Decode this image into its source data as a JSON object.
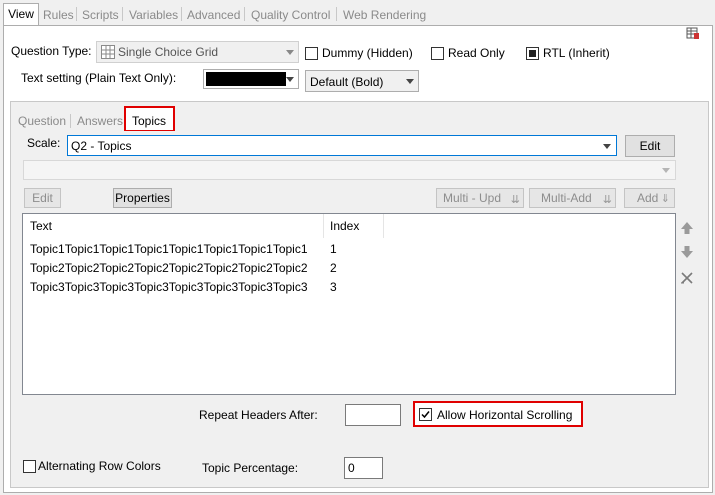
{
  "tabs": [
    "View",
    "Rules",
    "Scripts",
    "Variables",
    "Advanced",
    "Quality Control",
    "Web Rendering"
  ],
  "question_type": {
    "label": "Question Type:",
    "value": "Single Choice Grid"
  },
  "checkboxes": {
    "dummy": "Dummy (Hidden)",
    "read_only": "Read Only",
    "rtl": "RTL (Inherit)"
  },
  "text_setting": {
    "label": "Text setting (Plain Text Only):",
    "font_value": "Default (Bold)"
  },
  "subtabs": [
    "Question",
    "Answers",
    "Topics"
  ],
  "scale": {
    "label": "Scale:",
    "value": "Q2 - Topics",
    "edit": "Edit"
  },
  "toolbar": {
    "edit": "Edit",
    "properties": "Properties",
    "multi_upd": "Multi - Upd",
    "multi_add": "Multi-Add",
    "add": "Add"
  },
  "table": {
    "headers": [
      "Text",
      "Index"
    ],
    "rows": [
      [
        "Topic1Topic1Topic1Topic1Topic1Topic1Topic1Topic1",
        "1"
      ],
      [
        "Topic2Topic2Topic2Topic2Topic2Topic2Topic2Topic2",
        "2"
      ],
      [
        "Topic3Topic3Topic3Topic3Topic3Topic3Topic3Topic3",
        "3"
      ]
    ]
  },
  "bottom": {
    "repeat_headers": "Repeat Headers After:",
    "allow_hscroll": "Allow Horizontal Scrolling",
    "alternating": "Alternating Row Colors",
    "topic_pct": "Topic Percentage:",
    "topic_pct_value": "0"
  },
  "colors": {
    "highlight_red": "#e00000",
    "accent_blue": "#0078d7"
  }
}
